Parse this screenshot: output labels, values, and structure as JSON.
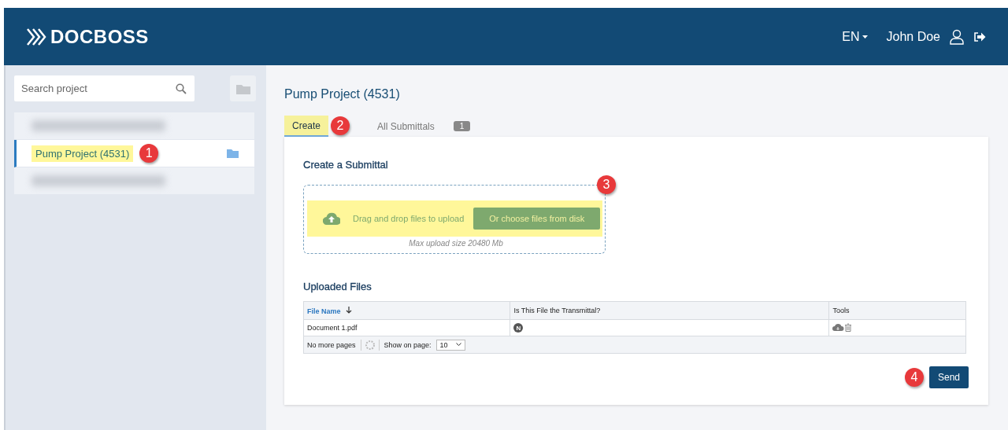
{
  "header": {
    "logo": "DOCBOSS",
    "language": "EN",
    "user": "John Doe"
  },
  "sidebar": {
    "search": {
      "placeholder": "Search project"
    },
    "projects": [
      {
        "kind": "redacted",
        "selected": false
      },
      {
        "kind": "project",
        "label": "Pump Project (4531)",
        "selected": true,
        "highlighted": true,
        "callout": "1"
      },
      {
        "kind": "redacted",
        "selected": false
      }
    ]
  },
  "main": {
    "title": "Pump Project (4531)",
    "tabs": [
      {
        "label": "Create",
        "selected": true,
        "highlighted": true,
        "callout": "2"
      },
      {
        "label": "All Submittals",
        "selected": false,
        "badge": "1"
      }
    ],
    "section_title": "Create a Submittal",
    "upload": {
      "callout": "3",
      "prompt": "Drag and drop files to upload",
      "button": "Or choose files from disk",
      "note": "Max upload size 20480 Mb"
    },
    "files_title": "Uploaded Files",
    "table": {
      "columns": [
        {
          "label": "File Name",
          "sorted": true
        },
        {
          "label": "Is This File the Transmittal?",
          "sorted": false
        },
        {
          "label": "Tools",
          "sorted": false
        }
      ],
      "rows": [
        {
          "file_name": "Document 1.pdf",
          "transmittal": "N"
        }
      ],
      "pager": {
        "status": "No more pages",
        "show_label": "Show on page:",
        "page_size": "10"
      }
    },
    "send": {
      "label": "Send",
      "callout": "4"
    }
  }
}
